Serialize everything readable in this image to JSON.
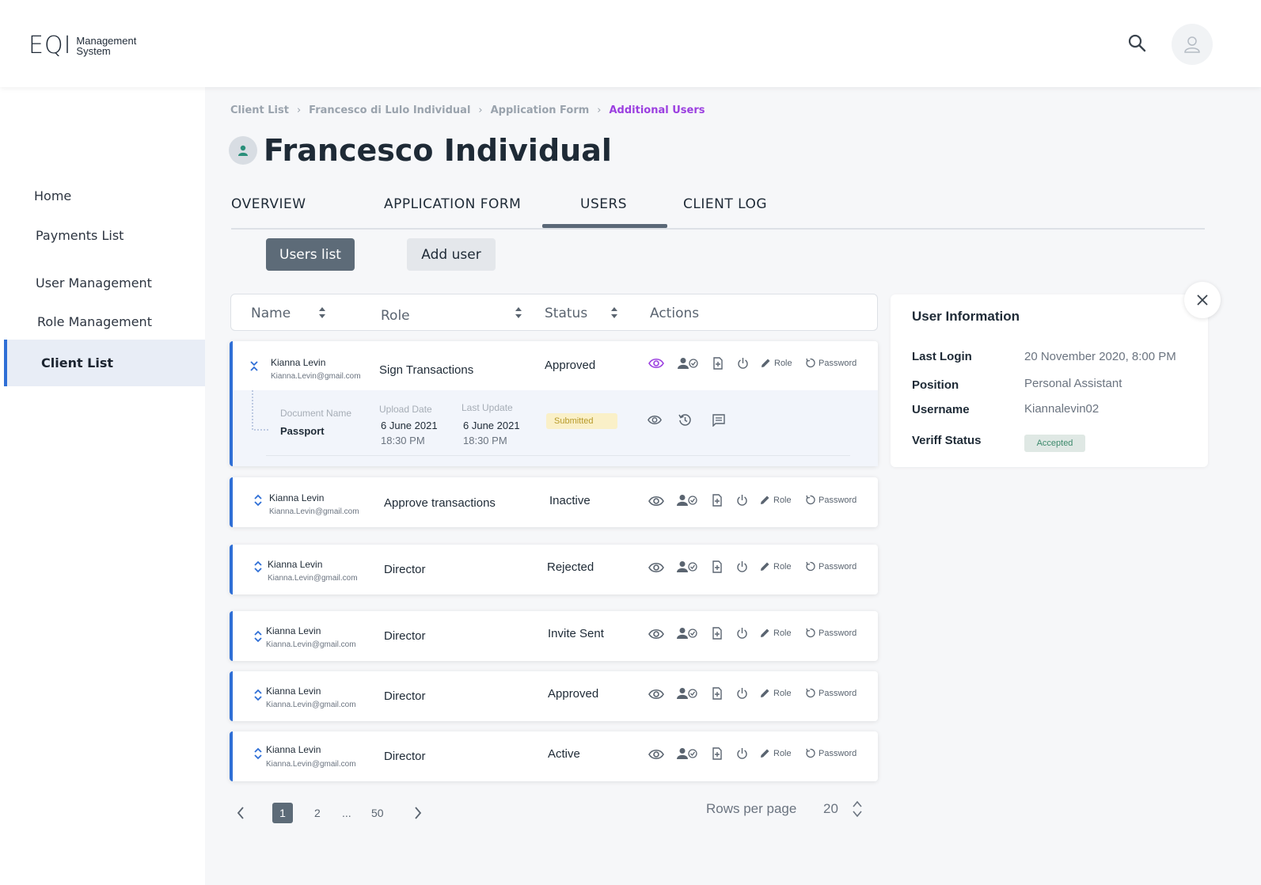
{
  "header": {
    "logo_mark": "EQI",
    "logo_line1": "Management",
    "logo_line2": "System"
  },
  "sidebar": {
    "items": [
      {
        "label": "Home"
      },
      {
        "label": "Payments List"
      },
      {
        "label": "User Management"
      },
      {
        "label": "Role Management"
      },
      {
        "label": "Client List",
        "active": true
      }
    ]
  },
  "breadcrumb": [
    "Client List",
    "Francesco di Lulo Individual",
    "Application Form",
    "Additional Users"
  ],
  "page_title": "Francesco Individual",
  "tabs": [
    {
      "label": "OVERVIEW"
    },
    {
      "label": "APPLICATION FORM"
    },
    {
      "label": "USERS",
      "active": true
    },
    {
      "label": "CLIENT LOG"
    }
  ],
  "subnav": {
    "users_list": "Users list",
    "add_user": "Add user"
  },
  "table": {
    "headers": {
      "name": "Name",
      "role": "Role",
      "status": "Status",
      "actions": "Actions"
    },
    "action_labels": {
      "role": "Role",
      "password": "Password"
    },
    "rows": [
      {
        "name": "Kianna Levin",
        "email": "Kianna.Levin@gmail.com",
        "role": "Sign Transactions",
        "status": "Approved",
        "expanded": true
      },
      {
        "name": "Kianna Levin",
        "email": "Kianna.Levin@gmail.com",
        "role": "Approve transactions",
        "status": "Inactive"
      },
      {
        "name": "Kianna Levin",
        "email": "Kianna.Levin@gmail.com",
        "role": "Director",
        "status": "Rejected"
      },
      {
        "name": "Kianna Levin",
        "email": "Kianna.Levin@gmail.com",
        "role": "Director",
        "status": "Invite Sent"
      },
      {
        "name": "Kianna Levin",
        "email": "Kianna.Levin@gmail.com",
        "role": "Director",
        "status": "Approved"
      },
      {
        "name": "Kianna Levin",
        "email": "Kianna.Levin@gmail.com",
        "role": "Director",
        "status": "Active"
      }
    ],
    "detail": {
      "doc_name_label": "Document Name",
      "doc_name": "Passport",
      "upload_label": "Upload Date",
      "upload_date": "6 June 2021",
      "upload_time": "18:30 PM",
      "update_label": "Last Update",
      "update_date": "6 June 2021",
      "update_time": "18:30 PM",
      "status": "Submitted"
    }
  },
  "pagination": {
    "pages": [
      "1",
      "2",
      "...",
      "50"
    ],
    "current": "1",
    "rows_per_page_label": "Rows per page",
    "rows_per_page": "20"
  },
  "info_panel": {
    "title": "User Information",
    "last_login_label": "Last Login",
    "last_login": "20 November 2020, 8:00 PM",
    "position_label": "Position",
    "position": "Personal Assistant",
    "username_label": "Username",
    "username": "Kiannalevin02",
    "veriff_label": "Veriff Status",
    "veriff": "Accepted"
  },
  "colors": {
    "accent": "#2f6fd6",
    "breadcrumb_current": "#9b3fe0",
    "active_view_icon": "#9b3fe0"
  }
}
